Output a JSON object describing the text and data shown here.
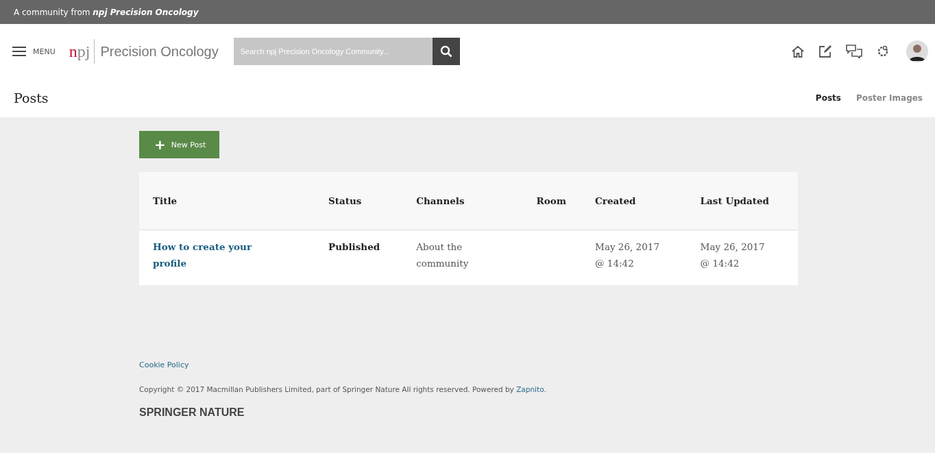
{
  "top_bar": {
    "text": "A community from **npj Precision Oncology**"
  },
  "header": {
    "menu_label": "MENU",
    "logo": {
      "mark": [
        "n",
        "pj"
      ],
      "name": "Precision Oncology"
    },
    "search": {
      "placeholder": "Search npj Precision Oncology Community..."
    }
  },
  "page_title": "Posts",
  "tabs": [
    {
      "label": "Posts",
      "selected": true
    },
    {
      "label": "Poster Images",
      "selected": false
    }
  ],
  "new_post_button": {
    "icon": "+",
    "label": "New Post"
  },
  "table": {
    "columns": [
      "Title",
      "Status",
      "Channels",
      "Room",
      "Created",
      "Last Updated"
    ],
    "rows": [
      {
        "title": "How to create your profile",
        "status": "Published",
        "channels": "About the community",
        "room": "",
        "created": [
          "May 26, 2017",
          "@ 14:42"
        ],
        "updated": [
          "May 26, 2017",
          "@ 14:42"
        ]
      }
    ]
  },
  "footer": {
    "cookie_link": "Cookie Policy",
    "copyright": "Copyright © 2017 Macmillan Publishers Limited, part of Springer Nature All rights reserved. Powered by ",
    "powered_link": "Zapnito",
    "copyright_end": ".",
    "logo": "SPRINGER NATURE"
  }
}
